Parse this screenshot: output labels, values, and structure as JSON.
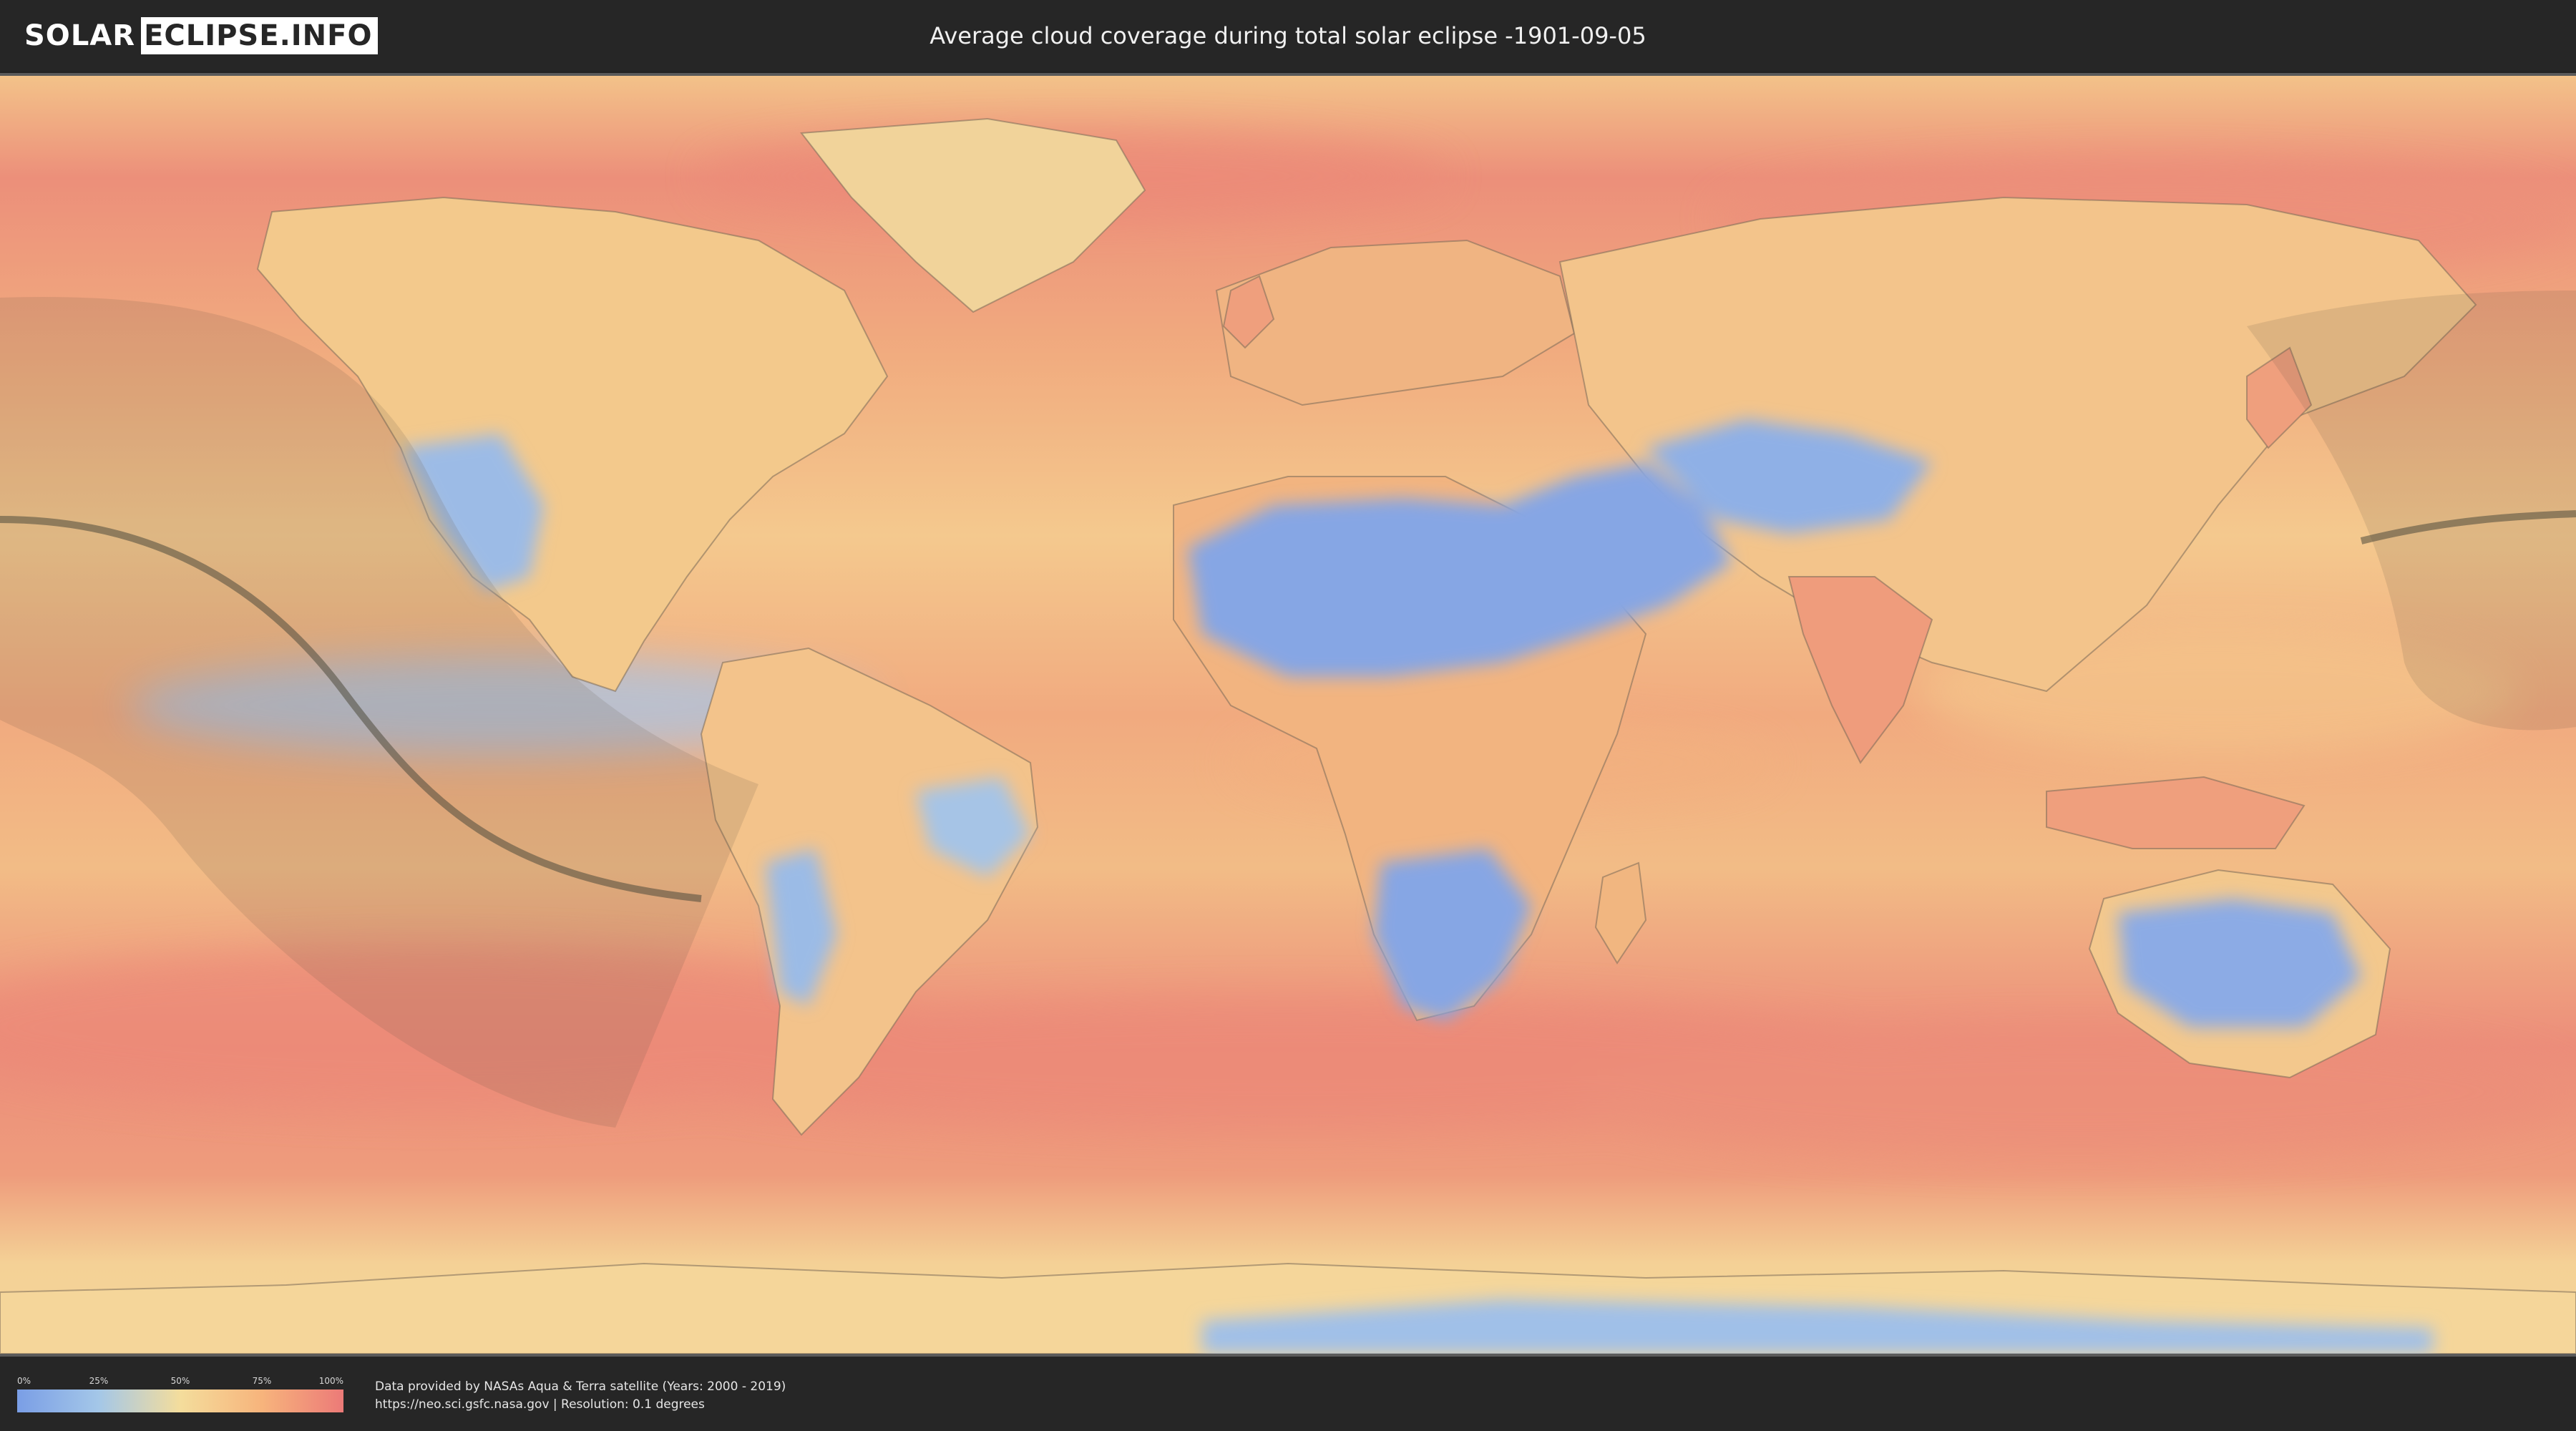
{
  "header": {
    "logo_left": "SOLAR",
    "logo_right": "ECLIPSE.INFO",
    "title": "Average cloud coverage during total solar eclipse -1901-09-05"
  },
  "legend": {
    "ticks": [
      "0%",
      "25%",
      "50%",
      "75%",
      "100%"
    ],
    "colors": [
      "#7a9ee6",
      "#a4c7e8",
      "#f4dd9c",
      "#f7b47c",
      "#ec7a78"
    ]
  },
  "footer": {
    "line1": "Data provided by NASAs Aqua & Terra satellite (Years: 2000 - 2019)",
    "line2": "https://neo.sci.gsfc.nasa.gov | Resolution: 0.1 degrees"
  },
  "map": {
    "colors": {
      "ocean_cloudy": "#ec8a78",
      "ocean_mid": "#f2b981",
      "clear": "#86a6e4",
      "light_clear": "#b8cfe6",
      "umbra_shade": "#5a5040",
      "coastline": "#7a6a58"
    }
  }
}
